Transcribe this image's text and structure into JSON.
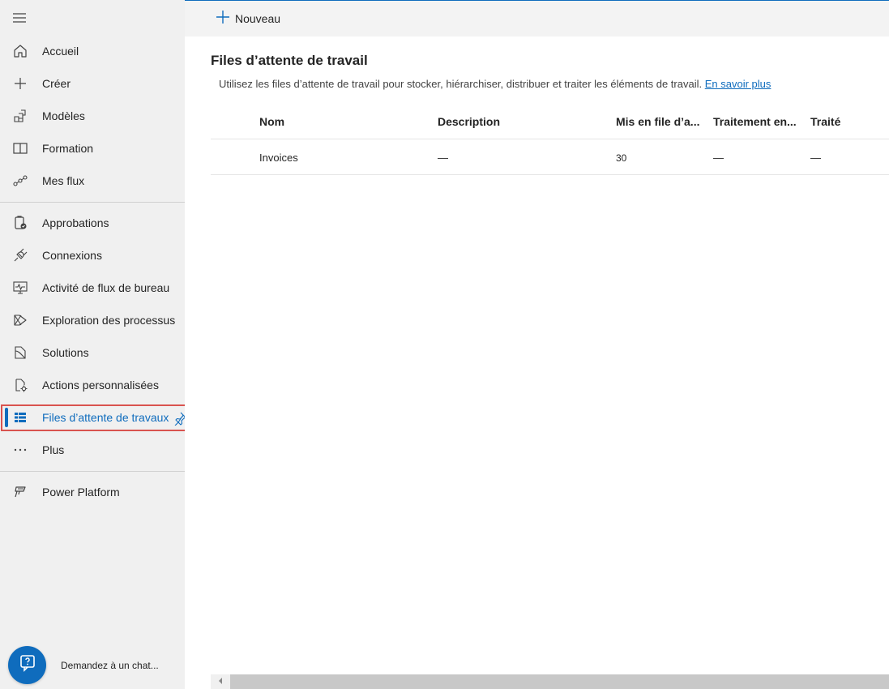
{
  "sidebar": {
    "menu_icon": "hamburger-icon",
    "items_group1": [
      {
        "label": "Accueil",
        "icon": "home-icon"
      },
      {
        "label": "Créer",
        "icon": "plus-icon"
      },
      {
        "label": "Modèles",
        "icon": "templates-icon"
      },
      {
        "label": "Formation",
        "icon": "book-icon"
      },
      {
        "label": "Mes flux",
        "icon": "flow-icon"
      }
    ],
    "items_group2": [
      {
        "label": "Approbations",
        "icon": "approvals-icon"
      },
      {
        "label": "Connexions",
        "icon": "plug-icon"
      },
      {
        "label": "Activité de flux de bureau",
        "icon": "monitor-activity-icon"
      },
      {
        "label": "Exploration des processus",
        "icon": "process-mining-icon"
      },
      {
        "label": "Solutions",
        "icon": "solutions-icon"
      },
      {
        "label": "Actions personnalisées",
        "icon": "custom-actions-icon"
      },
      {
        "label": "Files d’attente de travaux",
        "icon": "work-queue-icon",
        "selected": true
      },
      {
        "label": "Plus",
        "icon": "more-icon"
      }
    ],
    "items_group3": [
      {
        "label": "Power Platform",
        "icon": "power-platform-icon"
      }
    ],
    "pin_icon": "pin-icon",
    "chat": {
      "label": "Demandez à un chat...",
      "icon": "chatbot-icon"
    }
  },
  "toolbar": {
    "new_label": "Nouveau",
    "new_icon": "plus-icon"
  },
  "page": {
    "title": "Files d’attente de travail",
    "description": "Utilisez les files d’attente de travail pour stocker, hiérarchiser, distribuer et traiter les éléments de travail.",
    "learn_more": "En savoir plus"
  },
  "table": {
    "columns": [
      "Nom",
      "Description",
      "Mis en file d’a...",
      "Traitement en...",
      "Traité"
    ],
    "rows": [
      {
        "name": "Invoices",
        "description": "—",
        "queued": "30",
        "processing": "—",
        "processed": "—"
      }
    ]
  },
  "colors": {
    "accent": "#0f6cbd",
    "highlight_outline": "#d9534f",
    "sidebar_bg": "#f0f0f0"
  }
}
